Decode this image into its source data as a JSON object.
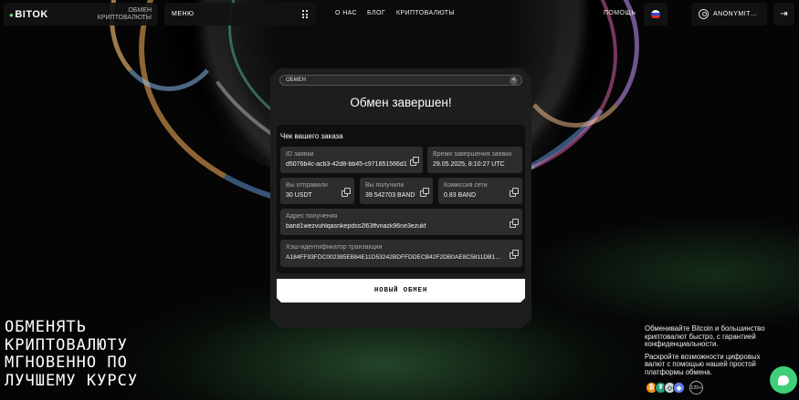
{
  "header": {
    "logo": "BITOK",
    "logo_sub_line1": "ОБМЕН",
    "logo_sub_line2": "КРИПТОВАЛЮТЫ",
    "menu_label": "МЕНЮ",
    "nav": [
      "О НАС",
      "БЛОГ",
      "КРИПТОВАЛЮТЫ"
    ],
    "help": "ПОМОЩЬ",
    "user_name": "ANONYMIT…",
    "logout_glyph": "⇥"
  },
  "modal": {
    "progress_label": "ОБМЕН",
    "progress_step": "4",
    "title": "Обмен завершен!",
    "receipt_title": "Чек вашего заказа",
    "fields": {
      "order_id": {
        "label": "ID заявки",
        "value": "d5076b4c-acb3-42d8-bb45-c971851566d1"
      },
      "completed_at": {
        "label": "Время завершения заявки",
        "value": "29.05.2025, 8:10:27 UTC"
      },
      "sent": {
        "label": "Вы отправили",
        "value": "30 USDT"
      },
      "received": {
        "label": "Вы получили",
        "value": "39.542703 BAND"
      },
      "fee": {
        "label": "Комиссия сети",
        "value": "0.83 BAND"
      },
      "address": {
        "label": "Адрес получения",
        "value": "band1wezvuhlqasnkepdss2l63ffvnazk96ne3ezukf"
      },
      "tx_hash": {
        "label": "Хэш-идентификатор транзакции",
        "value": "A184FF93FDC002385EB84E11D53242BDFFDDECB42F2DB0AE8C5811DB1A5..."
      }
    },
    "new_exchange_button": "НОВЫЙ ОБМЕН"
  },
  "hero": [
    "ОБМЕНЯТЬ",
    "КРИПТОВАЛЮТУ",
    "МГНОВЕННО ПО",
    "ЛУЧШЕМУ КУРСУ"
  ],
  "promo": {
    "p1": "Обменивайте Bitcoin и большинство криптовалют быстро, с гарантией конфиденциальности.",
    "p2": "Раскройте возможности цифровых валют с помощью нашей простой платформы обмена.",
    "more_count": "120+"
  },
  "colors": {
    "accent_green": "#3ecf78",
    "modal_bg": "#1d1d1d",
    "field_bg": "#2d2d2d"
  },
  "icons": [
    "grid-icon",
    "flag-ru-icon",
    "user-icon",
    "logout-icon",
    "copy-icon",
    "chat-icon"
  ]
}
